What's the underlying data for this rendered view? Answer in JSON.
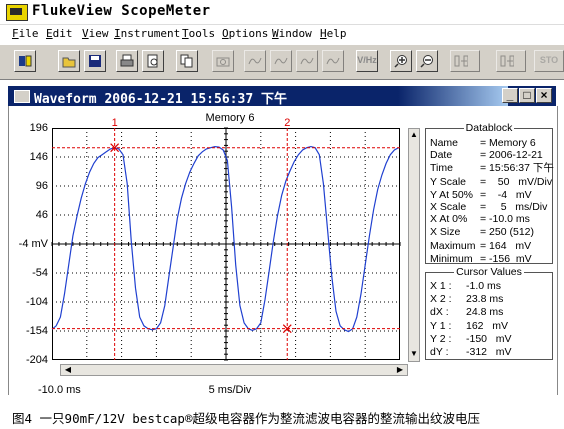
{
  "app": {
    "title": "FlukeView ScopeMeter",
    "menu": [
      "File",
      "Edit",
      "View",
      "Instrument",
      "Tools",
      "Options",
      "Window",
      "Help"
    ]
  },
  "toolbar": {
    "buttons": [
      {
        "name": "scopemeter-connect-icon",
        "enabled": true,
        "label": ""
      },
      {
        "name": "open-icon",
        "enabled": true,
        "label": ""
      },
      {
        "name": "save-icon",
        "enabled": true,
        "label": ""
      },
      {
        "name": "print-icon",
        "enabled": true,
        "label": ""
      },
      {
        "name": "print-preview-icon",
        "enabled": true,
        "label": ""
      },
      {
        "name": "copy-icon",
        "enabled": true,
        "label": ""
      },
      {
        "name": "camera-icon",
        "enabled": false,
        "label": ""
      },
      {
        "name": "waveform-1-icon",
        "enabled": false,
        "label": ""
      },
      {
        "name": "waveform-2-icon",
        "enabled": false,
        "label": ""
      },
      {
        "name": "waveform-3-icon",
        "enabled": false,
        "label": ""
      },
      {
        "name": "waveform-4-icon",
        "enabled": false,
        "label": ""
      },
      {
        "name": "volt-hz-icon",
        "enabled": true,
        "label": "V/Hz"
      },
      {
        "name": "zoom-in-icon",
        "enabled": true,
        "label": ""
      },
      {
        "name": "zoom-out-icon",
        "enabled": true,
        "label": ""
      },
      {
        "name": "cursor-left-icon",
        "enabled": false,
        "label": ""
      },
      {
        "name": "cursor-right-icon",
        "enabled": false,
        "label": ""
      },
      {
        "name": "stop-icon",
        "enabled": false,
        "label": "STO"
      }
    ]
  },
  "window": {
    "title": "Waveform  2006-12-21  15:56:37 下午",
    "controls": [
      "_",
      "□",
      "×"
    ]
  },
  "chart_data": {
    "type": "line",
    "title": "Memory 6",
    "ytick_labels": [
      "196",
      "146",
      "96",
      "46",
      "-4 mV",
      "-54",
      "-104",
      "-154",
      "-204"
    ],
    "ylim": [
      -204,
      196
    ],
    "xlabel": "5 ms/Div",
    "x_start_label": "-10.0 ms",
    "xlim": [
      -10,
      40
    ],
    "grid": true,
    "series": [
      {
        "color": "#2040d0",
        "x": [
          -10,
          -9.4,
          -8.8,
          -8.2,
          -7.6,
          -7.0,
          -6.4,
          -5.8,
          -5.2,
          -4.6,
          -4.0,
          -3.4,
          -2.8,
          -2.2,
          -1.6,
          -1.0,
          -0.4,
          0.2,
          0.8,
          1.4,
          2.0,
          2.6,
          3.2,
          3.8,
          4.4,
          5.0,
          5.6,
          6.2,
          6.8,
          7.4,
          8.0,
          8.6,
          9.2,
          9.8,
          10.4,
          11.0,
          11.6,
          12.2,
          12.8,
          13.4,
          14.0,
          14.6,
          15.2,
          15.8,
          16.4,
          17.0,
          17.6,
          18.2,
          18.8,
          19.4,
          20.0,
          20.6,
          21.2,
          21.8,
          22.4,
          23.0,
          23.6,
          24.2,
          24.8,
          25.4,
          26.0,
          26.6,
          27.2,
          27.8,
          28.4,
          29.0,
          29.6,
          30.2,
          30.8,
          31.4,
          32.0,
          32.6,
          33.2,
          33.8,
          34.4,
          35.0,
          35.6,
          36.2,
          36.8,
          37.4,
          38.0,
          38.6,
          39.2,
          39.8
        ],
        "y": [
          -151,
          -145,
          -130,
          -90,
          -40,
          10,
          45,
          75,
          100,
          120,
          135,
          145,
          150,
          155,
          160,
          162,
          160,
          150,
          100,
          0,
          -80,
          -130,
          -145,
          -150,
          -152,
          -150,
          -140,
          -110,
          -60,
          -10,
          40,
          75,
          100,
          120,
          135,
          148,
          155,
          160,
          162,
          164,
          163,
          158,
          140,
          60,
          -40,
          -110,
          -140,
          -150,
          -153,
          -150,
          -140,
          -100,
          -50,
          0,
          45,
          80,
          105,
          122,
          138,
          150,
          158,
          162,
          164,
          162,
          150,
          100,
          20,
          -60,
          -120,
          -145,
          -152,
          -155,
          -150,
          -130,
          -90,
          -40,
          10,
          55,
          90,
          115,
          135,
          150,
          158,
          162
        ]
      }
    ],
    "cursors": [
      {
        "label": "1",
        "x": -1.0,
        "y": 162
      },
      {
        "label": "2",
        "x": 23.8,
        "y": -150
      }
    ]
  },
  "datablock": {
    "title": "Datablock",
    "rows": [
      [
        "Name",
        "= Memory 6"
      ],
      [
        "Date",
        "= 2006-12-21"
      ],
      [
        "Time",
        "= 15:56:37 下午"
      ],
      [
        "Y Scale",
        "=    50   mV/Div"
      ],
      [
        "Y At 50%",
        "=    -4   mV"
      ],
      [
        "X Scale",
        "=     5   ms/Div"
      ],
      [
        "X At 0%",
        "= -10.0 ms"
      ],
      [
        "X Size",
        "= 250 (512)"
      ],
      [
        "Maximum",
        "= 164   mV"
      ],
      [
        "Minimum",
        "= -156  mV"
      ]
    ]
  },
  "cursor_values": {
    "title": "Cursor Values",
    "rows": [
      [
        "X 1 :",
        "-1.0 ms"
      ],
      [
        "X 2 :",
        "23.8 ms"
      ],
      [
        "dX :",
        "24.8 ms"
      ],
      [
        "Y 1 :",
        "162   mV"
      ],
      [
        "Y 2 :",
        "-150   mV"
      ],
      [
        "dY :",
        "-312   mV"
      ]
    ]
  },
  "caption": "图4 一只90mF/12V bestcap®超级电容器作为整流滤波电容器的整流输出纹波电压"
}
